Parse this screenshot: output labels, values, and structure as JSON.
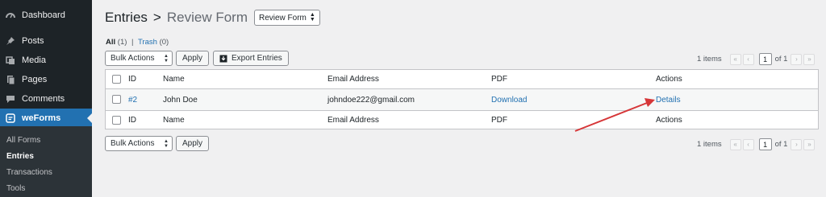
{
  "sidebar": {
    "items": [
      {
        "label": "Dashboard",
        "icon": "dashboard-icon"
      },
      {
        "label": "Posts",
        "icon": "pin-icon"
      },
      {
        "label": "Media",
        "icon": "media-icon"
      },
      {
        "label": "Pages",
        "icon": "pages-icon"
      },
      {
        "label": "Comments",
        "icon": "comment-icon"
      },
      {
        "label": "weForms",
        "icon": "weforms-icon"
      }
    ],
    "submenu": [
      "All Forms",
      "Entries",
      "Transactions",
      "Tools"
    ]
  },
  "header": {
    "title": "Entries",
    "separator": ">",
    "subtitle": "Review Form",
    "form_select": "Review Form"
  },
  "filters": {
    "all_label": "All",
    "all_count": "(1)",
    "divider": "|",
    "trash_label": "Trash",
    "trash_count": "(0)"
  },
  "toolbar": {
    "bulk_actions": "Bulk Actions",
    "apply": "Apply",
    "export": "Export Entries"
  },
  "pagination": {
    "items": "1 items",
    "first": "«",
    "prev": "‹",
    "page": "1",
    "of": "of 1",
    "next": "›",
    "last": "»"
  },
  "table": {
    "columns": [
      "ID",
      "Name",
      "Email Address",
      "PDF",
      "Actions"
    ],
    "row": {
      "id": "#2",
      "name": "John Doe",
      "email": "johndoe222@gmail.com",
      "pdf": "Download",
      "action": "Details"
    }
  },
  "colors": {
    "accent": "#2271b1",
    "sidebar": "#1d2327",
    "annotation": "#d63638"
  }
}
